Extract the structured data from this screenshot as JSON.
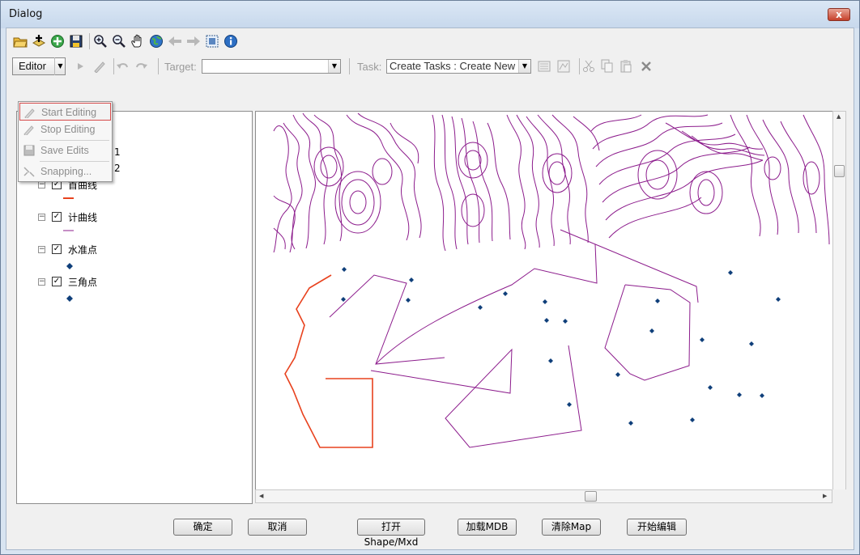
{
  "window": {
    "title": "Dialog",
    "close_glyph": "x"
  },
  "toolbar1": {
    "icons": [
      "open-icon",
      "add-data-icon",
      "add-layer-icon",
      "save-icon",
      "zoom-in-icon",
      "zoom-out-icon",
      "pan-icon",
      "full-extent-icon",
      "back-icon",
      "forward-icon",
      "select-icon",
      "identify-icon"
    ]
  },
  "toolbar2": {
    "editor_label": "Editor",
    "target_label": "Target:",
    "target_value": "",
    "task_label": "Task:",
    "task_value": "Create Tasks : Create New"
  },
  "editor_menu": {
    "items": [
      {
        "label": "Start Editing",
        "icon": "start-editing-icon",
        "highlighted": true
      },
      {
        "label": "Stop Editing",
        "icon": "stop-editing-icon"
      },
      {
        "label": "Save Edits",
        "icon": "save-edits-icon"
      },
      {
        "label": "Snapping...",
        "icon": "snapping-icon"
      }
    ]
  },
  "toc": {
    "partial_rows": [
      {
        "text": "1"
      },
      {
        "text": "2"
      }
    ],
    "layers": [
      {
        "name": "首曲线",
        "checked": true,
        "expanded": true,
        "symbol": "line",
        "color": "#e8421e"
      },
      {
        "name": "计曲线",
        "checked": true,
        "expanded": true,
        "symbol": "line",
        "color": "#8c1c8c"
      },
      {
        "name": "水准点",
        "checked": true,
        "expanded": true,
        "symbol": "point",
        "color": "#0f3f7a"
      },
      {
        "name": "三角点",
        "checked": true,
        "expanded": true,
        "symbol": "point",
        "color": "#0f3f7a"
      }
    ]
  },
  "buttons": {
    "ok": "确定",
    "cancel": "取消",
    "open_shape": "打开Shape/Mxd",
    "load_mdb": "加载MDB",
    "clear_map": "清除Map",
    "start_edit": "开始编辑"
  },
  "colors": {
    "contour": "#8c1c8c",
    "index_line": "#e8421e",
    "points": "#0f3f7a"
  }
}
